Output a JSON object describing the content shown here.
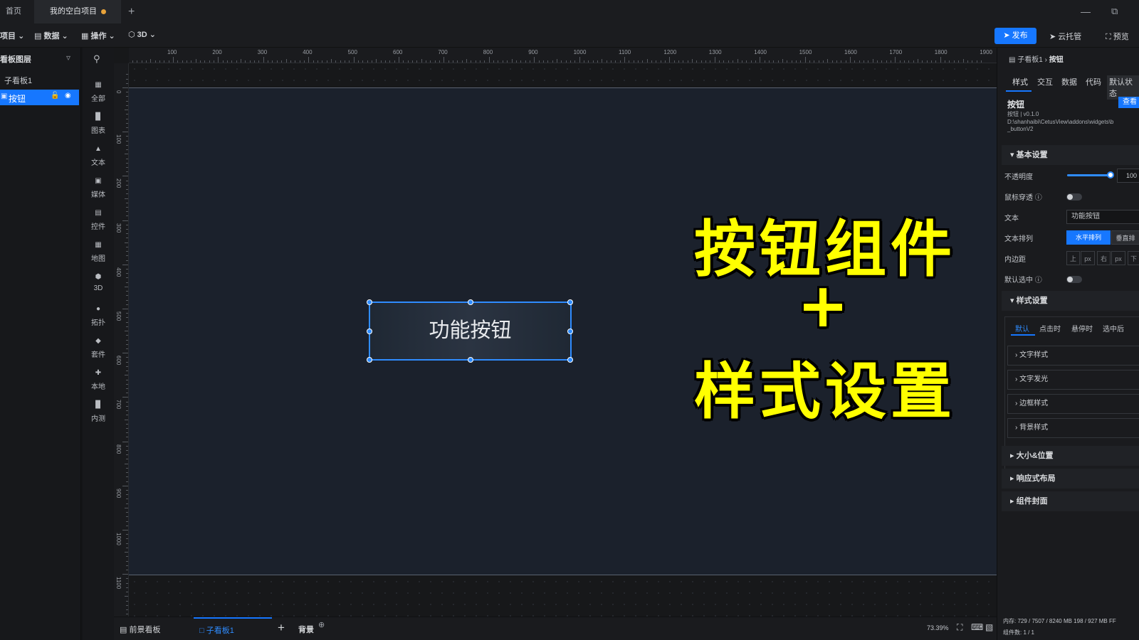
{
  "titlebar": {
    "tabs": [
      {
        "label": "首页"
      },
      {
        "label": "我的空白项目"
      }
    ],
    "new_tab": "+"
  },
  "toolbar": {
    "menus": [
      "项目",
      "数据",
      "操作",
      "3D"
    ],
    "publish": "发布",
    "cloud_host": "云托管",
    "preview": "预览"
  },
  "layers": {
    "title": "看板图层",
    "items": [
      {
        "label": "子看板1"
      },
      {
        "label": "按钮"
      }
    ]
  },
  "components": {
    "items": [
      "全部",
      "图表",
      "文本",
      "媒体",
      "控件",
      "地图",
      "3D",
      "拓扑",
      "套件",
      "本地",
      "内测"
    ]
  },
  "ruler": {
    "top": [
      "100",
      "200",
      "300",
      "400",
      "500",
      "600",
      "700",
      "800",
      "900",
      "1000",
      "1100",
      "1200",
      "1300",
      "1400",
      "1500",
      "1600",
      "1700",
      "1800",
      "1900"
    ],
    "left": [
      "0",
      "100",
      "200",
      "300",
      "400",
      "500",
      "600",
      "700",
      "800",
      "900",
      "1000",
      "1100"
    ]
  },
  "canvas": {
    "button_text": "功能按钮",
    "overlay_line1": "按钮组件",
    "overlay_line2": "+",
    "overlay_line3": "样式设置"
  },
  "bottombar": {
    "tabs": [
      "前景看板",
      "子看板1"
    ],
    "add": "+",
    "background": "背景",
    "zoom": "73.39%"
  },
  "rpanel": {
    "breadcrumb_parent": "子看板1",
    "breadcrumb_current": "按钮",
    "tabs": [
      "样式",
      "交互",
      "数据",
      "代码",
      "默认状态"
    ],
    "widget_name": "按钮",
    "view_btn": "查看",
    "widget_version": "按钮 | v0.1.0",
    "widget_path_1": "D:\\shanhaibi\\CetusView\\addons\\widgets\\b",
    "widget_path_2": "_buttonV2",
    "basic_section": "基本设置",
    "opacity_label": "不透明度",
    "opacity_value": "100",
    "opacity_level": 1.0,
    "mouse_through_label": "鼠标穿透",
    "text_label": "文本",
    "text_value": "功能按钮",
    "arrange_label": "文本排列",
    "arrange_h": "水平排列",
    "arrange_v": "垂直排",
    "padding_label": "内边距",
    "padding_top": "上",
    "padding_right": "右",
    "padding_bottom": "下",
    "padding_unit": "px",
    "default_select_label": "默认选中",
    "style_section": "样式设置",
    "state_tabs": [
      "默认",
      "点击时",
      "悬停时",
      "选中后"
    ],
    "style_items": [
      "文字样式",
      "文字发光",
      "边框样式",
      "背景样式"
    ],
    "collapsed_sections": [
      "大小&位置",
      "响应式布局",
      "组件封面"
    ],
    "memory": "内存: 729 / 7507 / 8240 MB  198 / 927 MB  FF",
    "count": "组件数: 1 / 1"
  },
  "colors": {
    "accent": "#1677ff",
    "overlay_text": "#ffff00",
    "selection": "#2f8cff"
  }
}
